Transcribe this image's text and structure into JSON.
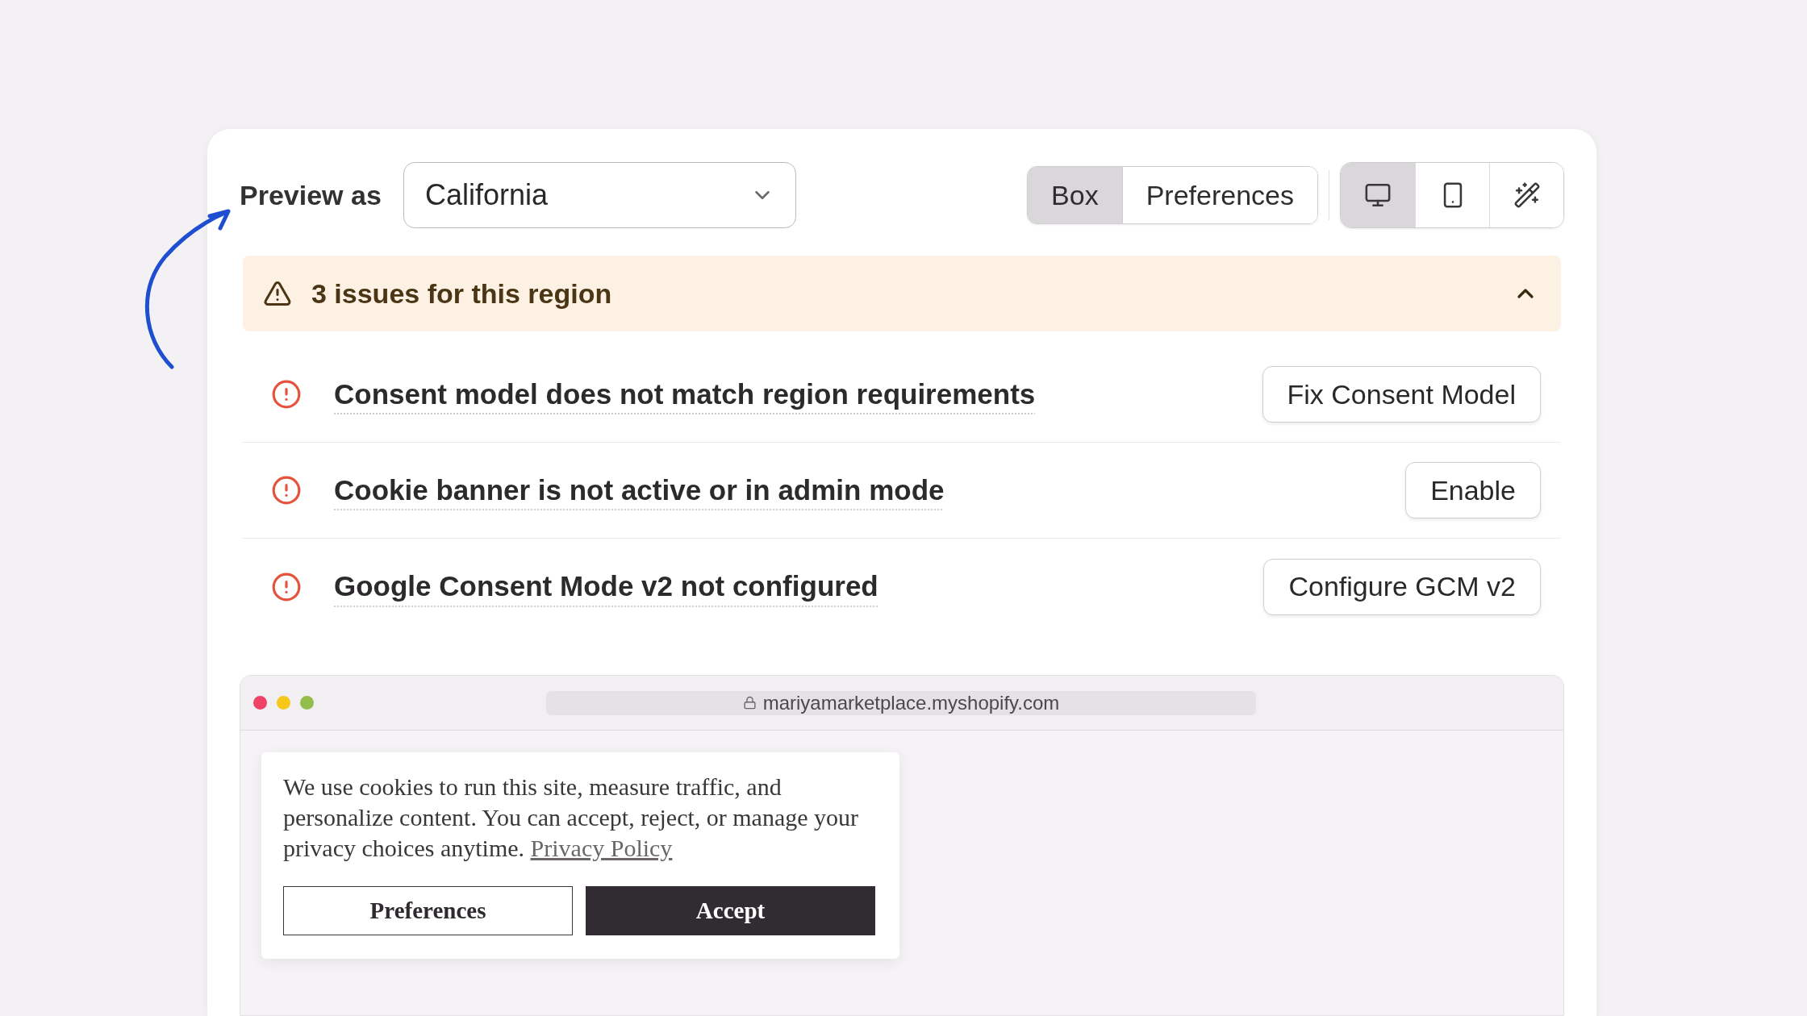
{
  "preview": {
    "label": "Preview as",
    "region_select": {
      "value": "California"
    }
  },
  "view_toggle": [
    {
      "label": "Box",
      "selected": true
    },
    {
      "label": "Preferences",
      "selected": false
    }
  ],
  "device_toggle": [
    {
      "kind": "desktop",
      "selected": true
    },
    {
      "kind": "mobile",
      "selected": false
    },
    {
      "kind": "editor",
      "selected": false
    }
  ],
  "issues_banner": {
    "title": "3 issues for this region",
    "expanded": true
  },
  "issues": [
    {
      "text": "Consent model does not match region requirements",
      "action": "Fix Consent Model"
    },
    {
      "text": "Cookie banner is not active or in admin mode",
      "action": "Enable"
    },
    {
      "text": "Google Consent Mode v2 not configured",
      "action": "Configure GCM v2"
    }
  ],
  "browser_preview": {
    "url": "mariyamarketplace.myshopify.com",
    "cookie_banner": {
      "message": "We use cookies to run this site, measure traffic, and personalize content. You can accept, reject, or manage your privacy choices anytime.",
      "link": "Privacy Policy",
      "buttons": [
        {
          "label": "Preferences",
          "kind": "secondary"
        },
        {
          "label": "Accept",
          "kind": "primary"
        }
      ]
    }
  }
}
